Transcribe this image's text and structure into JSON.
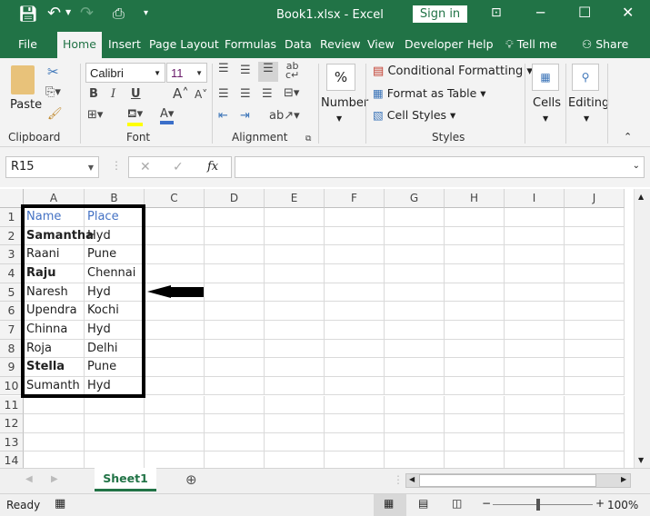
{
  "window": {
    "title": "Book1.xlsx  -  Excel",
    "sign_in": "Sign in"
  },
  "tabs": [
    "File",
    "Home",
    "Insert",
    "Page Layout",
    "Formulas",
    "Data",
    "Review",
    "View",
    "Developer",
    "Help",
    "Tell me",
    "Share"
  ],
  "ribbon": {
    "clipboard": {
      "paste": "Paste",
      "label": "Clipboard"
    },
    "font": {
      "name": "Calibri",
      "size": "11",
      "label": "Font",
      "bold": "B",
      "italic": "I",
      "underline": "U"
    },
    "alignment": {
      "label": "Alignment"
    },
    "number": {
      "label": "Number",
      "symbol": "%"
    },
    "styles": {
      "conditional": "Conditional Formatting",
      "format_table": "Format as Table",
      "cell_styles": "Cell Styles",
      "label": "Styles"
    },
    "cells": {
      "label": "Cells"
    },
    "editing": {
      "label": "Editing"
    }
  },
  "formula_bar": {
    "name_box": "R15",
    "cancel": "✕",
    "enter": "✓",
    "fx": "fx",
    "value": ""
  },
  "columns": [
    "A",
    "B",
    "C",
    "D",
    "E",
    "F",
    "G",
    "H",
    "I",
    "J"
  ],
  "rows": [
    "1",
    "2",
    "3",
    "4",
    "5",
    "6",
    "7",
    "8",
    "9",
    "10",
    "11",
    "12",
    "13",
    "14"
  ],
  "cells": [
    {
      "a": "Name",
      "b": "Place",
      "header": true
    },
    {
      "a": "Samantha",
      "b": "Hyd",
      "bold": true
    },
    {
      "a": "Raani",
      "b": "Pune"
    },
    {
      "a": "Raju",
      "b": "Chennai",
      "bold": true
    },
    {
      "a": "Naresh",
      "b": "Hyd"
    },
    {
      "a": "Upendra",
      "b": "Kochi"
    },
    {
      "a": "Chinna",
      "b": "Hyd"
    },
    {
      "a": "Roja",
      "b": "Delhi"
    },
    {
      "a": "Stella",
      "b": "Pune",
      "bold": true
    },
    {
      "a": "Sumanth",
      "b": "Hyd"
    }
  ],
  "sheet_tab": "Sheet1",
  "status": {
    "ready": "Ready",
    "zoom": "100%"
  },
  "colors": {
    "accent": "#217346",
    "header_text": "#4472c4"
  }
}
